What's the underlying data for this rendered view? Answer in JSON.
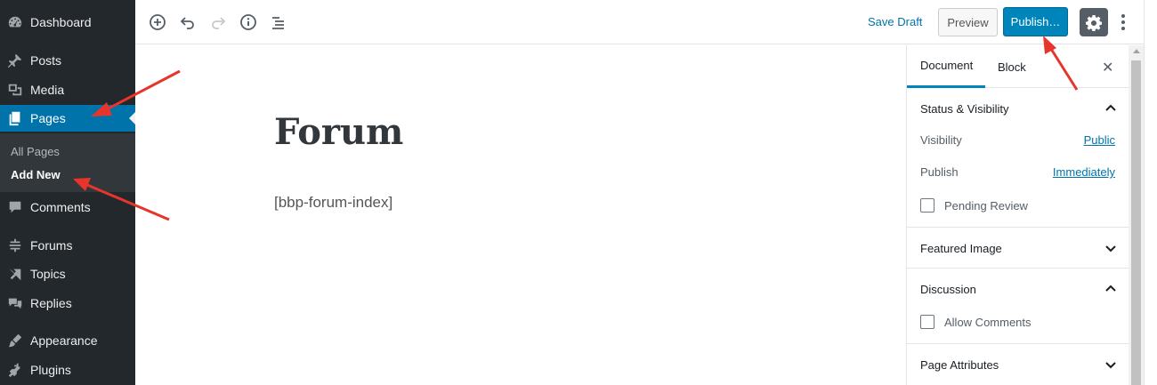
{
  "admin_menu": {
    "items": [
      {
        "label": "Dashboard",
        "icon": "dashboard-icon"
      },
      {
        "label": "Posts",
        "icon": "pin-icon"
      },
      {
        "label": "Media",
        "icon": "media-icon"
      },
      {
        "label": "Pages",
        "icon": "pages-icon",
        "current": true
      },
      {
        "label": "Comments",
        "icon": "comment-icon"
      },
      {
        "label": "Forums",
        "icon": "forums-icon"
      },
      {
        "label": "Topics",
        "icon": "topics-icon"
      },
      {
        "label": "Replies",
        "icon": "replies-icon"
      },
      {
        "label": "Appearance",
        "icon": "brush-icon"
      },
      {
        "label": "Plugins",
        "icon": "plug-icon"
      }
    ],
    "submenu": [
      {
        "label": "All Pages"
      },
      {
        "label": "Add New",
        "current": true
      }
    ]
  },
  "toolbar": {
    "save_draft": "Save Draft",
    "preview": "Preview",
    "publish": "Publish…",
    "icons": [
      "add-block-icon",
      "undo-icon",
      "redo-icon",
      "info-icon",
      "outline-icon",
      "gear-icon",
      "more-vertical-icon"
    ]
  },
  "editor": {
    "title": "Forum",
    "content": "[bbp-forum-index]"
  },
  "settings": {
    "tabs": [
      "Document",
      "Block"
    ],
    "active_tab": "Document",
    "panels": {
      "status": {
        "title": "Status & Visibility",
        "visibility_label": "Visibility",
        "visibility_value": "Public",
        "publish_label": "Publish",
        "publish_value": "Immediately",
        "pending_review": "Pending Review"
      },
      "featured_image": {
        "title": "Featured Image"
      },
      "discussion": {
        "title": "Discussion",
        "allow_comments": "Allow Comments"
      },
      "page_attributes": {
        "title": "Page Attributes"
      }
    }
  },
  "colors": {
    "admin_bg": "#23282d",
    "admin_current": "#0073aa",
    "publish_button": "#0085ba",
    "link": "#0073aa",
    "annotation": "#e8352b"
  }
}
